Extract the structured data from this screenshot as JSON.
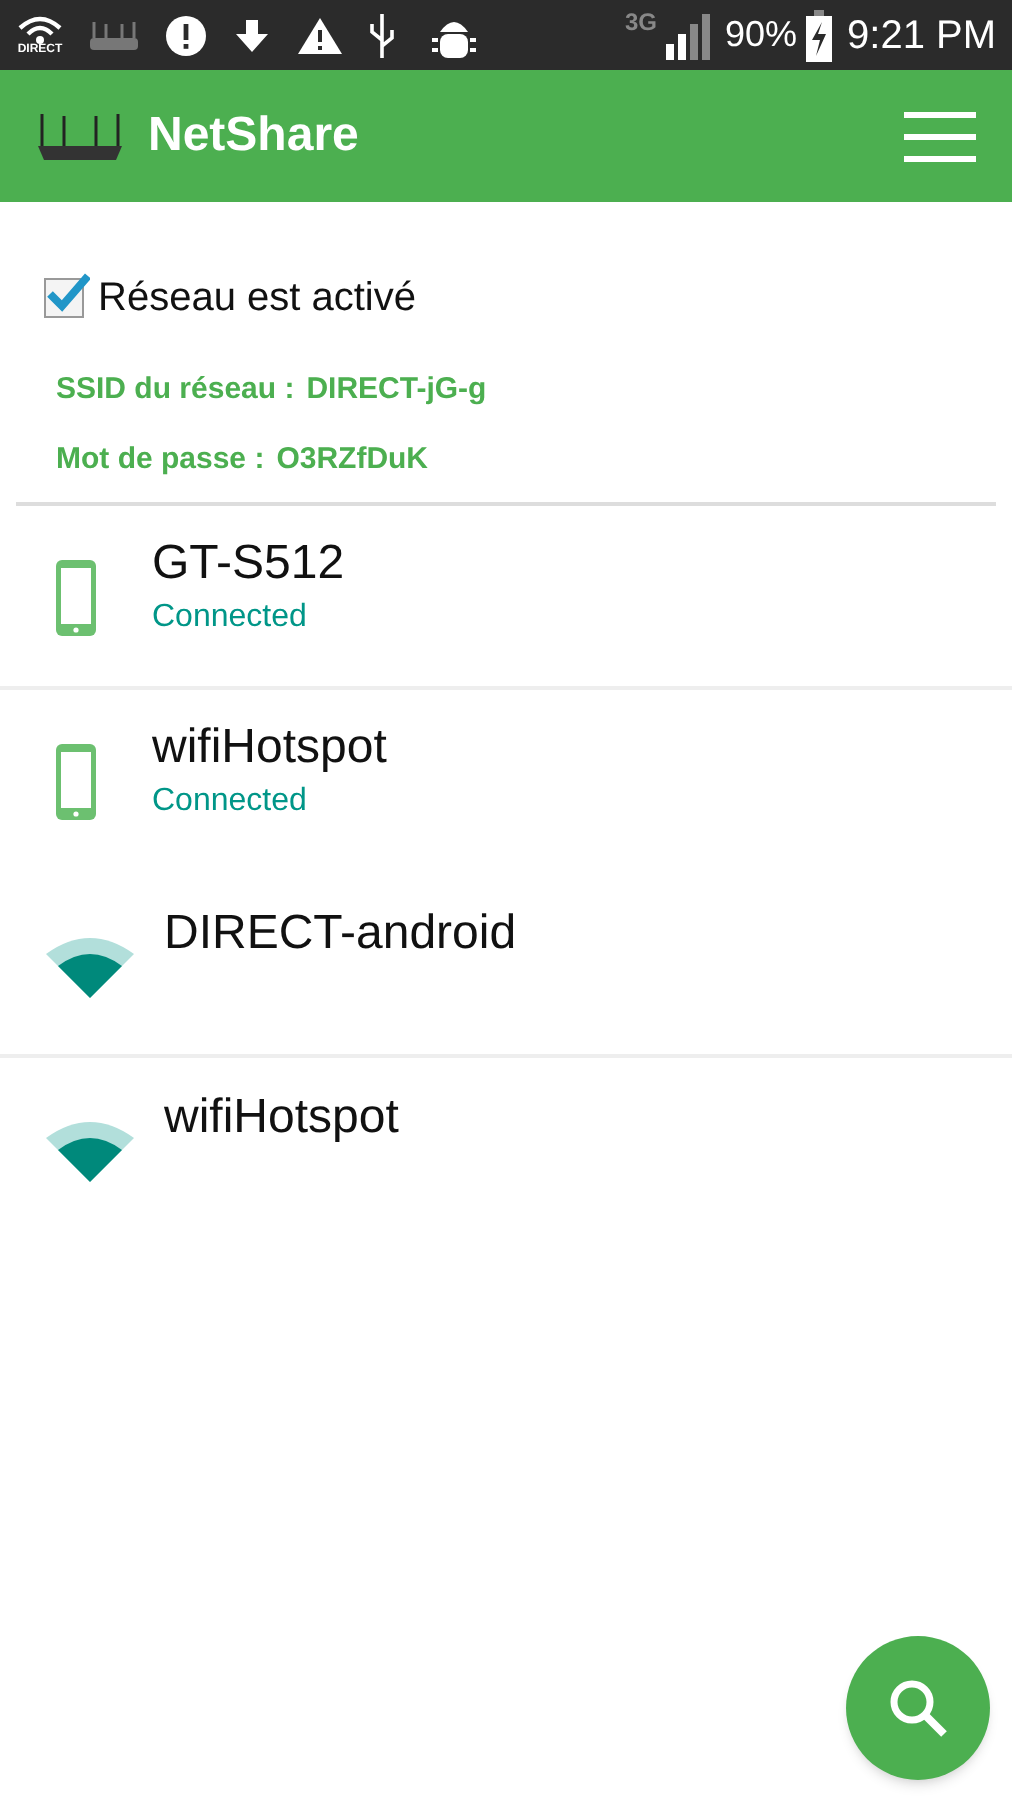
{
  "status_bar": {
    "wifi_label": "DIRECT",
    "network": "3G",
    "battery": "90%",
    "time": "9:21 PM"
  },
  "app_bar": {
    "title": "NetShare"
  },
  "network_toggle": {
    "label": "Réseau est activé",
    "checked": true
  },
  "ssid": {
    "label": "SSID du réseau :",
    "value": "DIRECT-jG-g"
  },
  "password": {
    "label": "Mot de passe :",
    "value": "O3RZfDuK"
  },
  "devices": [
    {
      "kind": "phone",
      "name": "GT-S512",
      "status": "Connected",
      "separated": true
    },
    {
      "kind": "phone",
      "name": "wifiHotspot",
      "status": "Connected",
      "separated": false
    },
    {
      "kind": "wifi",
      "name": "DIRECT-android",
      "separated": true
    },
    {
      "kind": "wifi",
      "name": "wifiHotspot",
      "separated": false
    }
  ]
}
